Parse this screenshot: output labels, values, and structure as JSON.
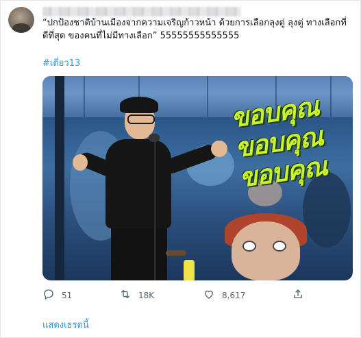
{
  "tweet": {
    "text": "“ปกป้องชาติบ้านเมืองจากความเจริญก้าวหน้า ด้วยการเลือกลุงตู่ ลุงตู่ ทางเลือกที่ดีที่สุด ของคนที่ไม่มีทางเลือก” 55555555555555",
    "hashtag": "#เดี่ยว13",
    "image_caption": [
      "ขอบคุณ",
      "ขอบคุณ",
      "ขอบคุณ"
    ]
  },
  "actions": {
    "reply_count": "51",
    "retweet_count": "18K",
    "like_count": "8,617"
  },
  "footer": {
    "show_thread": "แสดงเธรดนี้"
  },
  "colors": {
    "accent": "#1d9bf0",
    "text": "#0f1419",
    "muted": "#536471",
    "caption": "#c7f22c"
  },
  "icons": {
    "reply": "reply-icon",
    "retweet": "retweet-icon",
    "like": "like-icon",
    "share": "share-icon"
  }
}
